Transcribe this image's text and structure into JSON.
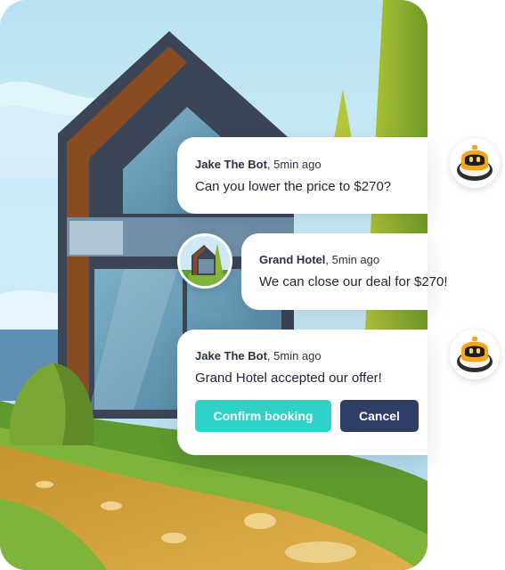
{
  "conversation": {
    "messages": [
      {
        "author": "Jake The Bot",
        "time": ", 5min ago",
        "text": "Can you lower the price to $270?",
        "avatar_icon": "robot-icon"
      },
      {
        "author": "Grand Hotel",
        "time": ", 5min ago",
        "text": "We can close our deal for $270!",
        "avatar_icon": "house-icon"
      },
      {
        "author": "Jake The Bot",
        "time": ", 5min ago",
        "text": "Grand Hotel accepted our offer!",
        "avatar_icon": "robot-icon",
        "actions": {
          "confirm_label": "Confirm booking",
          "cancel_label": "Cancel"
        }
      }
    ]
  },
  "colors": {
    "confirm_button": "#2ed2c9",
    "cancel_button": "#2f3d67",
    "message_background": "#ffffff",
    "text": "#1d2433",
    "robot_head": "#f3a51b"
  },
  "illustration": {
    "subject": "modern-house-icon"
  }
}
